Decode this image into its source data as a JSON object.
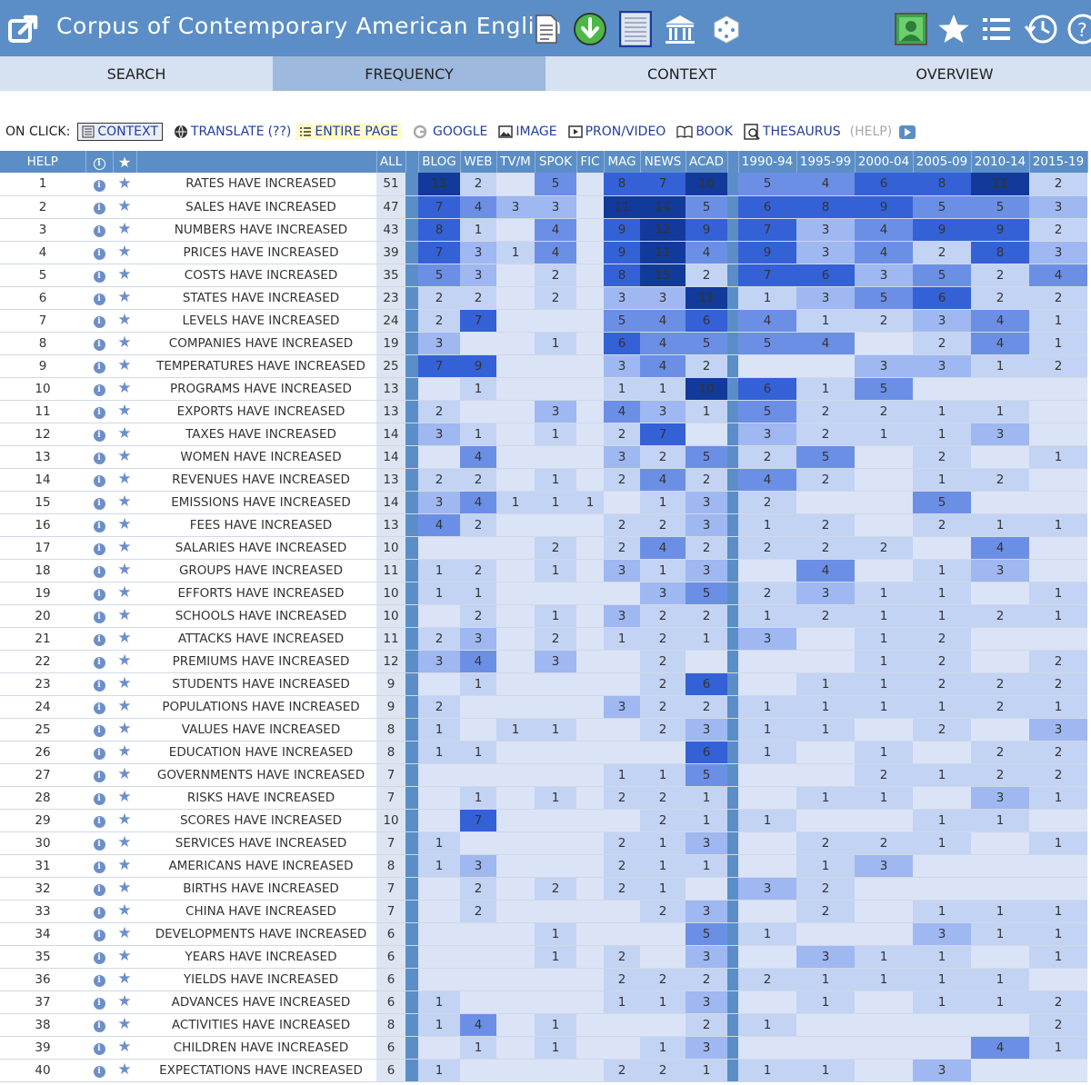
{
  "app": {
    "title": "Corpus of Contemporary American English"
  },
  "tabs": [
    {
      "label": "SEARCH",
      "active": false
    },
    {
      "label": "FREQUENCY",
      "active": true
    },
    {
      "label": "CONTEXT",
      "active": false
    },
    {
      "label": "OVERVIEW",
      "active": false
    }
  ],
  "onclick": {
    "label": "ON CLICK:",
    "options": [
      {
        "label": "CONTEXT",
        "icon": "page-icon"
      },
      {
        "label": "TRANSLATE",
        "icon": "globe-icon"
      },
      {
        "label": "(??)",
        "icon": ""
      },
      {
        "label": "ENTIRE PAGE",
        "icon": "list-icon"
      },
      {
        "label": "GOOGLE",
        "icon": "google-icon"
      },
      {
        "label": "IMAGE",
        "icon": "image-icon"
      },
      {
        "label": "PRON/VIDEO",
        "icon": "video-icon"
      },
      {
        "label": "BOOK",
        "icon": "book-icon"
      },
      {
        "label": "THESAURUS",
        "icon": "thesaurus-icon"
      },
      {
        "label": "(HELP)",
        "icon": ""
      }
    ]
  },
  "table": {
    "headers": {
      "help": "HELP",
      "all": "ALL",
      "genres": [
        "BLOG",
        "WEB",
        "TV/M",
        "SPOK",
        "FIC",
        "MAG",
        "NEWS",
        "ACAD"
      ],
      "periods": [
        "1990-94",
        "1995-99",
        "2000-04",
        "2005-09",
        "2010-14",
        "2015-19"
      ]
    },
    "rows": [
      {
        "n": "1",
        "word": "RATES HAVE INCREASED",
        "all": "51",
        "g": [
          "13",
          "2",
          "",
          "5",
          "",
          "8",
          "7",
          "16"
        ],
        "p": [
          "5",
          "4",
          "6",
          "8",
          "11",
          "2"
        ]
      },
      {
        "n": "2",
        "word": "SALES HAVE INCREASED",
        "all": "47",
        "g": [
          "7",
          "4",
          "3",
          "3",
          "",
          "11",
          "14",
          "5"
        ],
        "p": [
          "6",
          "8",
          "9",
          "5",
          "5",
          "3"
        ]
      },
      {
        "n": "3",
        "word": "NUMBERS HAVE INCREASED",
        "all": "43",
        "g": [
          "8",
          "1",
          "",
          "4",
          "",
          "9",
          "12",
          "9"
        ],
        "p": [
          "7",
          "3",
          "4",
          "9",
          "9",
          "2"
        ]
      },
      {
        "n": "4",
        "word": "PRICES HAVE INCREASED",
        "all": "39",
        "g": [
          "7",
          "3",
          "1",
          "4",
          "",
          "9",
          "11",
          "4"
        ],
        "p": [
          "9",
          "3",
          "4",
          "2",
          "8",
          "3"
        ]
      },
      {
        "n": "5",
        "word": "COSTS HAVE INCREASED",
        "all": "35",
        "g": [
          "5",
          "3",
          "",
          "2",
          "",
          "8",
          "15",
          "2"
        ],
        "p": [
          "7",
          "6",
          "3",
          "5",
          "2",
          "4"
        ]
      },
      {
        "n": "6",
        "word": "STATES HAVE INCREASED",
        "all": "23",
        "g": [
          "2",
          "2",
          "",
          "2",
          "",
          "3",
          "3",
          "11"
        ],
        "p": [
          "1",
          "3",
          "5",
          "6",
          "2",
          "2"
        ]
      },
      {
        "n": "7",
        "word": "LEVELS HAVE INCREASED",
        "all": "24",
        "g": [
          "2",
          "7",
          "",
          "",
          "",
          "5",
          "4",
          "6"
        ],
        "p": [
          "4",
          "1",
          "2",
          "3",
          "4",
          "1"
        ]
      },
      {
        "n": "8",
        "word": "COMPANIES HAVE INCREASED",
        "all": "19",
        "g": [
          "3",
          "",
          "",
          "1",
          "",
          "6",
          "4",
          "5"
        ],
        "p": [
          "5",
          "4",
          "",
          "2",
          "4",
          "1"
        ]
      },
      {
        "n": "9",
        "word": "TEMPERATURES HAVE INCREASED",
        "all": "25",
        "g": [
          "7",
          "9",
          "",
          "",
          "",
          "3",
          "4",
          "2"
        ],
        "p": [
          "",
          "",
          "3",
          "3",
          "1",
          "2"
        ]
      },
      {
        "n": "10",
        "word": "PROGRAMS HAVE INCREASED",
        "all": "13",
        "g": [
          "",
          "1",
          "",
          "",
          "",
          "1",
          "1",
          "10"
        ],
        "p": [
          "6",
          "1",
          "5",
          "",
          "",
          ""
        ]
      },
      {
        "n": "11",
        "word": "EXPORTS HAVE INCREASED",
        "all": "13",
        "g": [
          "2",
          "",
          "",
          "3",
          "",
          "4",
          "3",
          "1"
        ],
        "p": [
          "5",
          "2",
          "2",
          "1",
          "1",
          ""
        ]
      },
      {
        "n": "12",
        "word": "TAXES HAVE INCREASED",
        "all": "14",
        "g": [
          "3",
          "1",
          "",
          "1",
          "",
          "2",
          "7",
          ""
        ],
        "p": [
          "3",
          "2",
          "1",
          "1",
          "3",
          ""
        ]
      },
      {
        "n": "13",
        "word": "WOMEN HAVE INCREASED",
        "all": "14",
        "g": [
          "",
          "4",
          "",
          "",
          "",
          "3",
          "2",
          "5"
        ],
        "p": [
          "2",
          "5",
          "",
          "2",
          "",
          "1"
        ]
      },
      {
        "n": "14",
        "word": "REVENUES HAVE INCREASED",
        "all": "13",
        "g": [
          "2",
          "2",
          "",
          "1",
          "",
          "2",
          "4",
          "2"
        ],
        "p": [
          "4",
          "2",
          "",
          "1",
          "2",
          ""
        ]
      },
      {
        "n": "15",
        "word": "EMISSIONS HAVE INCREASED",
        "all": "14",
        "g": [
          "3",
          "4",
          "1",
          "1",
          "1",
          "",
          "1",
          "3"
        ],
        "p": [
          "2",
          "",
          "",
          "5",
          "",
          ""
        ]
      },
      {
        "n": "16",
        "word": "FEES HAVE INCREASED",
        "all": "13",
        "g": [
          "4",
          "2",
          "",
          "",
          "",
          "2",
          "2",
          "3"
        ],
        "p": [
          "1",
          "2",
          "",
          "2",
          "1",
          "1"
        ]
      },
      {
        "n": "17",
        "word": "SALARIES HAVE INCREASED",
        "all": "10",
        "g": [
          "",
          "",
          "",
          "2",
          "",
          "2",
          "4",
          "2"
        ],
        "p": [
          "2",
          "2",
          "2",
          "",
          "4",
          ""
        ]
      },
      {
        "n": "18",
        "word": "GROUPS HAVE INCREASED",
        "all": "11",
        "g": [
          "1",
          "2",
          "",
          "1",
          "",
          "3",
          "1",
          "3"
        ],
        "p": [
          "",
          "4",
          "",
          "1",
          "3",
          ""
        ]
      },
      {
        "n": "19",
        "word": "EFFORTS HAVE INCREASED",
        "all": "10",
        "g": [
          "1",
          "1",
          "",
          "",
          "",
          "",
          "3",
          "5"
        ],
        "p": [
          "2",
          "3",
          "1",
          "1",
          "",
          "1"
        ]
      },
      {
        "n": "20",
        "word": "SCHOOLS HAVE INCREASED",
        "all": "10",
        "g": [
          "",
          "2",
          "",
          "1",
          "",
          "3",
          "2",
          "2"
        ],
        "p": [
          "1",
          "2",
          "1",
          "1",
          "2",
          "1"
        ]
      },
      {
        "n": "21",
        "word": "ATTACKS HAVE INCREASED",
        "all": "11",
        "g": [
          "2",
          "3",
          "",
          "2",
          "",
          "1",
          "2",
          "1"
        ],
        "p": [
          "3",
          "",
          "1",
          "2",
          "",
          ""
        ]
      },
      {
        "n": "22",
        "word": "PREMIUMS HAVE INCREASED",
        "all": "12",
        "g": [
          "3",
          "4",
          "",
          "3",
          "",
          "",
          "2",
          ""
        ],
        "p": [
          "",
          "",
          "1",
          "2",
          "",
          "2"
        ]
      },
      {
        "n": "23",
        "word": "STUDENTS HAVE INCREASED",
        "all": "9",
        "g": [
          "",
          "1",
          "",
          "",
          "",
          "",
          "2",
          "6"
        ],
        "p": [
          "",
          "1",
          "1",
          "2",
          "2",
          "2"
        ]
      },
      {
        "n": "24",
        "word": "POPULATIONS HAVE INCREASED",
        "all": "9",
        "g": [
          "2",
          "",
          "",
          "",
          "",
          "3",
          "2",
          "2"
        ],
        "p": [
          "1",
          "1",
          "1",
          "1",
          "2",
          "1"
        ]
      },
      {
        "n": "25",
        "word": "VALUES HAVE INCREASED",
        "all": "8",
        "g": [
          "1",
          "",
          "1",
          "1",
          "",
          "",
          "2",
          "3"
        ],
        "p": [
          "1",
          "1",
          "",
          "2",
          "",
          "3"
        ]
      },
      {
        "n": "26",
        "word": "EDUCATION HAVE INCREASED",
        "all": "8",
        "g": [
          "1",
          "1",
          "",
          "",
          "",
          "",
          "",
          "6"
        ],
        "p": [
          "1",
          "",
          "1",
          "",
          "2",
          "2"
        ]
      },
      {
        "n": "27",
        "word": "GOVERNMENTS HAVE INCREASED",
        "all": "7",
        "g": [
          "",
          "",
          "",
          "",
          "",
          "1",
          "1",
          "5"
        ],
        "p": [
          "",
          "",
          "2",
          "1",
          "2",
          "2"
        ]
      },
      {
        "n": "28",
        "word": "RISKS HAVE INCREASED",
        "all": "7",
        "g": [
          "",
          "1",
          "",
          "1",
          "",
          "2",
          "2",
          "1"
        ],
        "p": [
          "",
          "1",
          "1",
          "",
          "3",
          "1"
        ]
      },
      {
        "n": "29",
        "word": "SCORES HAVE INCREASED",
        "all": "10",
        "g": [
          "",
          "7",
          "",
          "",
          "",
          "",
          "2",
          "1"
        ],
        "p": [
          "1",
          "",
          "",
          "1",
          "1",
          ""
        ]
      },
      {
        "n": "30",
        "word": "SERVICES HAVE INCREASED",
        "all": "7",
        "g": [
          "1",
          "",
          "",
          "",
          "",
          "2",
          "1",
          "3"
        ],
        "p": [
          "",
          "2",
          "2",
          "1",
          "",
          "1"
        ]
      },
      {
        "n": "31",
        "word": "AMERICANS HAVE INCREASED",
        "all": "8",
        "g": [
          "1",
          "3",
          "",
          "",
          "",
          "2",
          "1",
          "1"
        ],
        "p": [
          "",
          "1",
          "3",
          "",
          "",
          ""
        ]
      },
      {
        "n": "32",
        "word": "BIRTHS HAVE INCREASED",
        "all": "7",
        "g": [
          "",
          "2",
          "",
          "2",
          "",
          "2",
          "1",
          ""
        ],
        "p": [
          "3",
          "2",
          "",
          "",
          "",
          ""
        ]
      },
      {
        "n": "33",
        "word": "CHINA HAVE INCREASED",
        "all": "7",
        "g": [
          "",
          "2",
          "",
          "",
          "",
          "",
          "2",
          "3"
        ],
        "p": [
          "",
          "2",
          "",
          "1",
          "1",
          "1"
        ]
      },
      {
        "n": "34",
        "word": "DEVELOPMENTS HAVE INCREASED",
        "all": "6",
        "g": [
          "",
          "",
          "",
          "1",
          "",
          "",
          "",
          "5"
        ],
        "p": [
          "1",
          "",
          "",
          "3",
          "1",
          "1"
        ]
      },
      {
        "n": "35",
        "word": "YEARS HAVE INCREASED",
        "all": "6",
        "g": [
          "",
          "",
          "",
          "1",
          "",
          "2",
          "",
          "3"
        ],
        "p": [
          "",
          "3",
          "1",
          "1",
          "",
          "1"
        ]
      },
      {
        "n": "36",
        "word": "YIELDS HAVE INCREASED",
        "all": "6",
        "g": [
          "",
          "",
          "",
          "",
          "",
          "2",
          "2",
          "2"
        ],
        "p": [
          "2",
          "1",
          "1",
          "1",
          "1",
          ""
        ]
      },
      {
        "n": "37",
        "word": "ADVANCES HAVE INCREASED",
        "all": "6",
        "g": [
          "1",
          "",
          "",
          "",
          "",
          "1",
          "1",
          "3"
        ],
        "p": [
          "",
          "1",
          "",
          "1",
          "1",
          "2"
        ]
      },
      {
        "n": "38",
        "word": "ACTIVITIES HAVE INCREASED",
        "all": "8",
        "g": [
          "1",
          "4",
          "",
          "1",
          "",
          "",
          "",
          "2"
        ],
        "p": [
          "1",
          "",
          "",
          "",
          "",
          "2"
        ]
      },
      {
        "n": "39",
        "word": "CHILDREN HAVE INCREASED",
        "all": "6",
        "g": [
          "",
          "1",
          "",
          "1",
          "",
          "",
          "1",
          "3"
        ],
        "p": [
          "",
          "",
          "",
          "",
          "4",
          "1"
        ]
      },
      {
        "n": "40",
        "word": "EXPECTATIONS HAVE INCREASED",
        "all": "6",
        "g": [
          "1",
          "",
          "",
          "",
          "",
          "2",
          "2",
          "1"
        ],
        "p": [
          "1",
          "1",
          "",
          "3",
          "",
          ""
        ]
      }
    ]
  }
}
